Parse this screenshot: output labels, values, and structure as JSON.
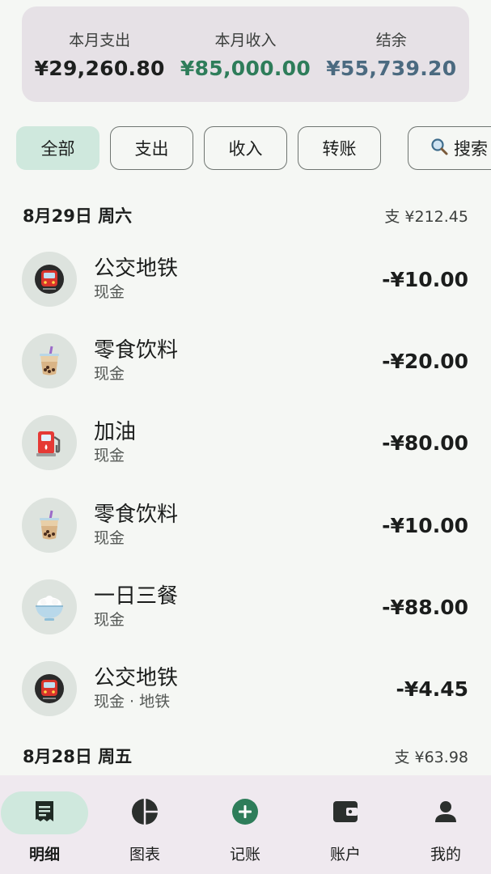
{
  "summary": {
    "expense": {
      "label": "本月支出",
      "value": "¥29,260.80"
    },
    "income": {
      "label": "本月收入",
      "value": "¥85,000.00"
    },
    "balance": {
      "label": "结余",
      "value": "¥55,739.20"
    }
  },
  "filters": {
    "all": "全部",
    "expense": "支出",
    "income": "收入",
    "transfer": "转账",
    "search": "搜索",
    "active": "全部"
  },
  "days": [
    {
      "date": "8月29日 周六",
      "total": "支 ¥212.45",
      "transactions": [
        {
          "icon": "metro-icon",
          "category": "公交地铁",
          "account": "现金",
          "amount": "-¥10.00"
        },
        {
          "icon": "bubble-tea-icon",
          "category": "零食饮料",
          "account": "现金",
          "amount": "-¥20.00"
        },
        {
          "icon": "fuel-pump-icon",
          "category": "加油",
          "account": "现金",
          "amount": "-¥80.00"
        },
        {
          "icon": "bubble-tea-icon",
          "category": "零食饮料",
          "account": "现金",
          "amount": "-¥10.00"
        },
        {
          "icon": "rice-bowl-icon",
          "category": "一日三餐",
          "account": "现金",
          "amount": "-¥88.00"
        },
        {
          "icon": "metro-icon",
          "category": "公交地铁",
          "account": "现金 · 地铁",
          "amount": "-¥4.45"
        }
      ]
    },
    {
      "date": "8月28日 周五",
      "total": "支 ¥63.98",
      "transactions": []
    }
  ],
  "nav": {
    "details": "明细",
    "charts": "图表",
    "add": "记账",
    "accounts": "账户",
    "mine": "我的",
    "active": "明细"
  },
  "colors": {
    "accent_green": "#2e7d5a",
    "balance_blue": "#4b6a80",
    "active_chip": "#cfe8dd"
  }
}
